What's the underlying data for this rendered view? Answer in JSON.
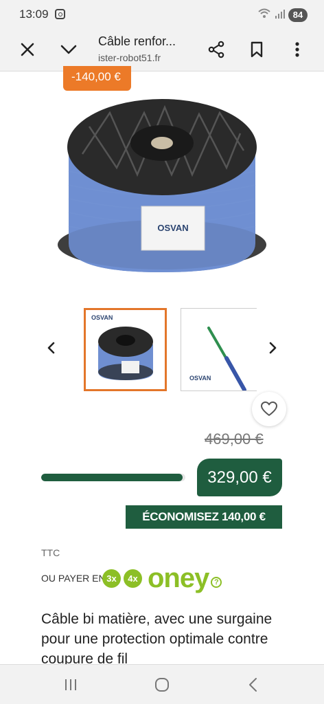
{
  "status_bar": {
    "time": "13:09",
    "battery": "84"
  },
  "toolbar": {
    "title": "Câble renfor...",
    "url": "⁠ister-robot51.fr"
  },
  "product": {
    "discount_badge": "-140,00 €",
    "old_price": "469,00 €",
    "new_price": "329,00 €",
    "savings": "ÉCONOMISEZ 140,00 €",
    "tax_note": "TTC",
    "pay_label": "OU PAYER EN",
    "oney": {
      "opt1": "3x",
      "opt2": "4x",
      "brand": "oney",
      "help": "?"
    },
    "description": "Câble bi matière, avec une surgaine pour une protection optimale contre coupure de fil",
    "progress_fraction": 0.98,
    "brand_logo": "OSVAN"
  },
  "colors": {
    "accent_green": "#1f5d3f",
    "badge_orange": "#ec7a28",
    "oney_green": "#8cbf26"
  }
}
